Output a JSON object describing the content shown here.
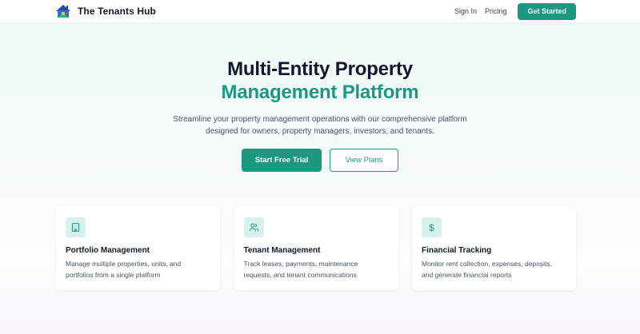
{
  "header": {
    "brand_name": "The Tenants Hub",
    "nav": {
      "sign_in": "Sign In",
      "pricing": "Pricing",
      "get_started": "Get Started"
    }
  },
  "hero": {
    "title_line1": "Multi-Entity Property",
    "title_line2": "Management Platform",
    "subtitle_line1": "Streamline your property management operations with our comprehensive platform",
    "subtitle_line2": "designed for owners, property managers, investors, and tenants.",
    "primary_cta": "Start Free Trial",
    "secondary_cta": "View Plans"
  },
  "features": [
    {
      "icon": "building-icon",
      "title": "Portfolio Management",
      "desc_line1": "Manage multiple properties, units, and",
      "desc_line2": "portfolios from a single platform"
    },
    {
      "icon": "users-icon",
      "title": "Tenant Management",
      "desc_line1": "Track leases, payments, maintenance",
      "desc_line2": "requests, and tenant communications"
    },
    {
      "icon": "dollar-icon",
      "icon_glyph": "$",
      "title": "Financial Tracking",
      "desc_line1": "Monitor rent collection, expenses, deposits,",
      "desc_line2": "and generate financial reports"
    }
  ],
  "colors": {
    "brand": "#1b9880",
    "icon_bg": "#d7f2ea",
    "heading": "#0f172a",
    "body_text": "#4b5563"
  }
}
